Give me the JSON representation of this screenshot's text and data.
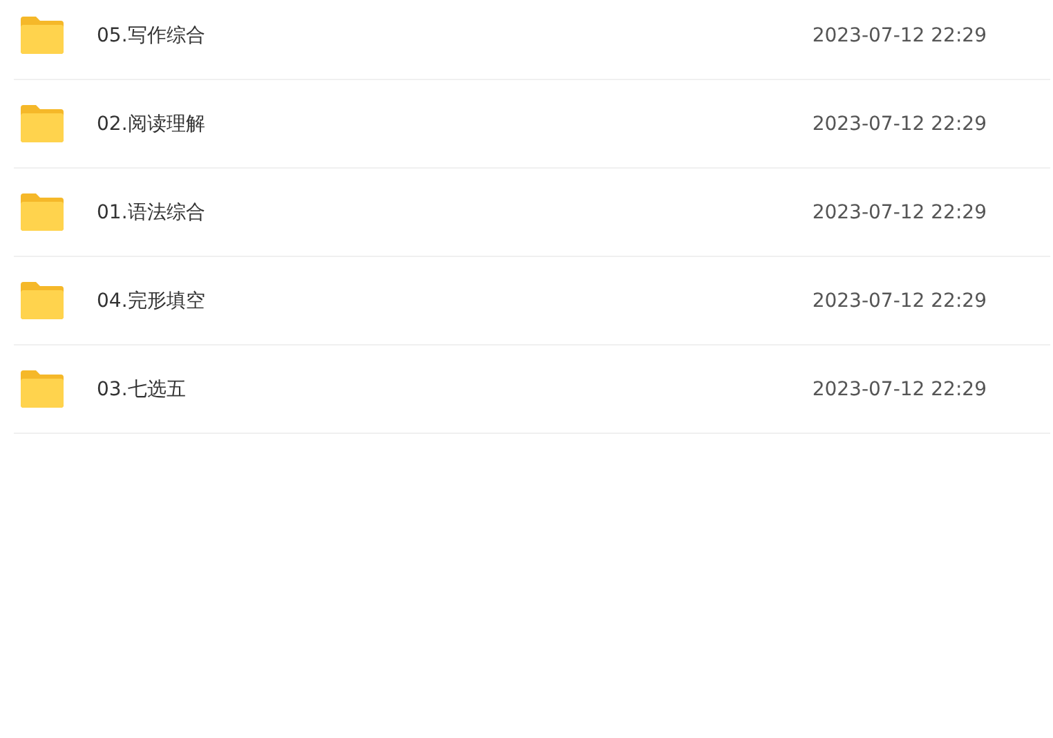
{
  "files": [
    {
      "name": "05.写作综合",
      "modified": "2023-07-12 22:29"
    },
    {
      "name": "02.阅读理解",
      "modified": "2023-07-12 22:29"
    },
    {
      "name": "01.语法综合",
      "modified": "2023-07-12 22:29"
    },
    {
      "name": "04.完形填空",
      "modified": "2023-07-12 22:29"
    },
    {
      "name": "03.七选五",
      "modified": "2023-07-12 22:29"
    }
  ]
}
